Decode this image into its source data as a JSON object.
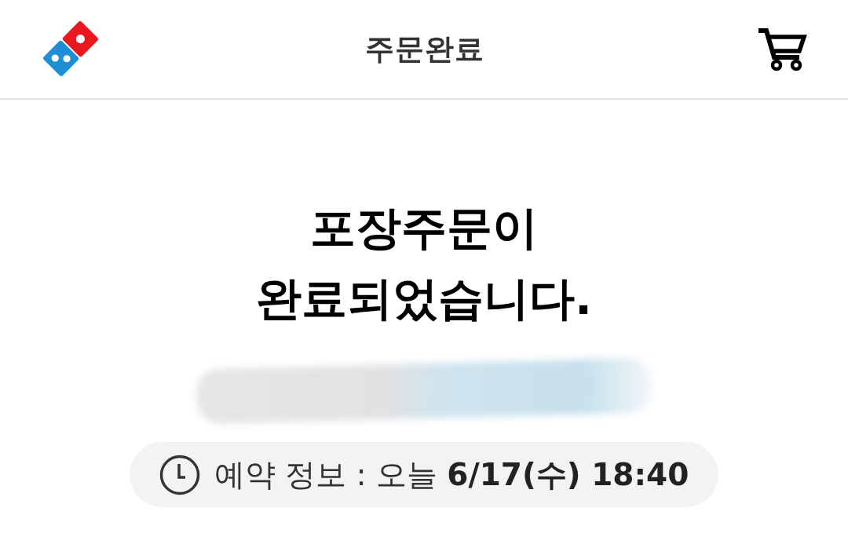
{
  "header": {
    "title": "주문완료"
  },
  "message": {
    "text": "포장주문이 완료되었습니다."
  },
  "reservation": {
    "text": "예약 정보 : 오늘 **6/17(수) 18:40**"
  }
}
